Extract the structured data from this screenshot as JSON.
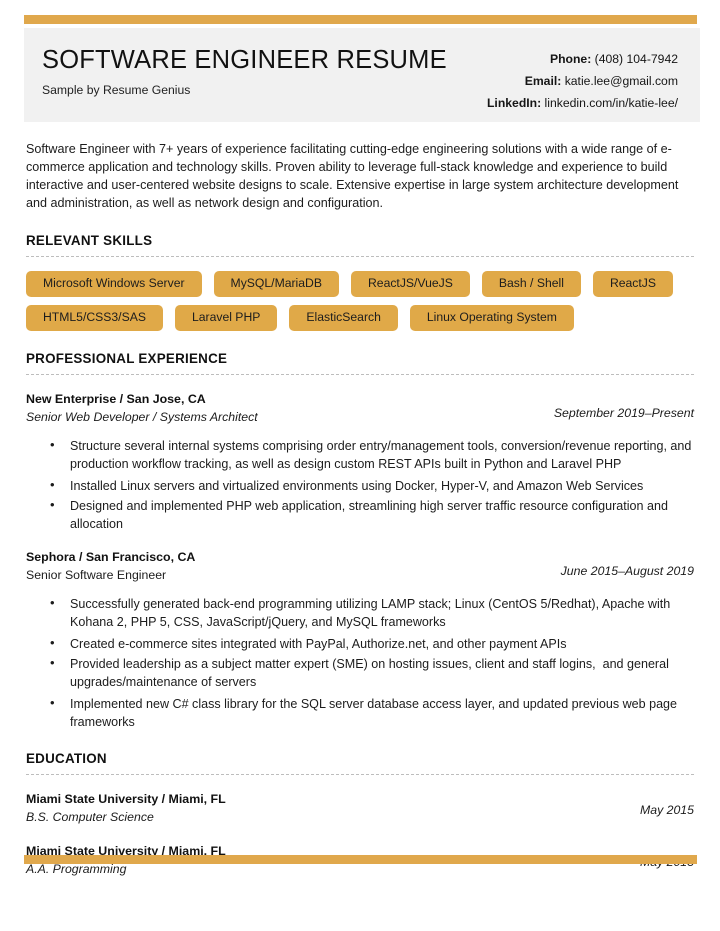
{
  "theme": {
    "accent": "#e0a84c",
    "pill_bg": "#e0a948",
    "header_band_bg": "#f1f1f1",
    "text": "#1c1c1c",
    "rule": "#bdbdbd"
  },
  "header": {
    "title": "SOFTWARE ENGINEER RESUME",
    "subtitle": "Sample by Resume Genius",
    "contacts": [
      {
        "label": "Phone:",
        "value": "(408) 104-7942"
      },
      {
        "label": "Email:",
        "value": "katie.lee@gmail.com"
      },
      {
        "label": "LinkedIn:",
        "value": "linkedin.com/in/katie-lee/"
      }
    ]
  },
  "summary": "Software Engineer with 7+ years of experience facilitating cutting-edge engineering solutions with a wide range of e-commerce application and technology skills. Proven ability to leverage full-stack knowledge and experience to build interactive and user-centered website designs to scale. Extensive expertise in large system architecture development and administration, as well as network design and configuration.",
  "sections": {
    "skills": {
      "heading": "RELEVANT SKILLS",
      "items": [
        "Microsoft Windows Server",
        "MySQL/MariaDB",
        "ReactJS/VueJS",
        "Bash / Shell",
        "ReactJS",
        "HTML5/CSS3/SAS",
        "Laravel PHP",
        "ElasticSearch",
        "Linux Operating System"
      ]
    },
    "experience": {
      "heading": "PROFESSIONAL EXPERIENCE",
      "jobs": [
        {
          "company": "New Enterprise / San Jose, CA",
          "role": "Senior Web Developer / Systems Architect",
          "role_italic": true,
          "date": "September 2019–Present",
          "bullets": [
            "Structure several internal systems comprising order entry/management tools, conversion/revenue reporting, and production workflow tracking, as well as design custom REST APIs built in Python and Laravel PHP",
            "Installed Linux servers and virtualized environments using Docker, Hyper-V, and Amazon Web Services",
            "Designed and implemented PHP web application, streamlining high server traffic resource configuration and allocation"
          ]
        },
        {
          "company": "Sephora / San Francisco, CA",
          "role": "Senior Software Engineer",
          "role_italic": false,
          "date": "June 2015–August 2019",
          "bullets": [
            "Successfully generated back-end programming utilizing LAMP stack; Linux (CentOS 5/Redhat), Apache with Kohana 2, PHP 5, CSS, JavaScript/jQuery, and MySQL frameworks",
            "Created e-commerce sites integrated with PayPal, Authorize.net, and other payment APIs",
            "Provided leadership as a subject matter expert (SME) on hosting issues, client and staff logins,  and general upgrades/maintenance of servers",
            "Implemented new C# class library for the SQL server database access layer, and updated previous web page frameworks"
          ]
        }
      ]
    },
    "education": {
      "heading": "EDUCATION",
      "entries": [
        {
          "school": "Miami State University / Miami, FL",
          "degree": "B.S. Computer Science",
          "date": "May 2015"
        },
        {
          "school": "Miami State University / Miami, FL",
          "degree": "A.A. Programming",
          "date": "May 2013"
        }
      ]
    }
  }
}
